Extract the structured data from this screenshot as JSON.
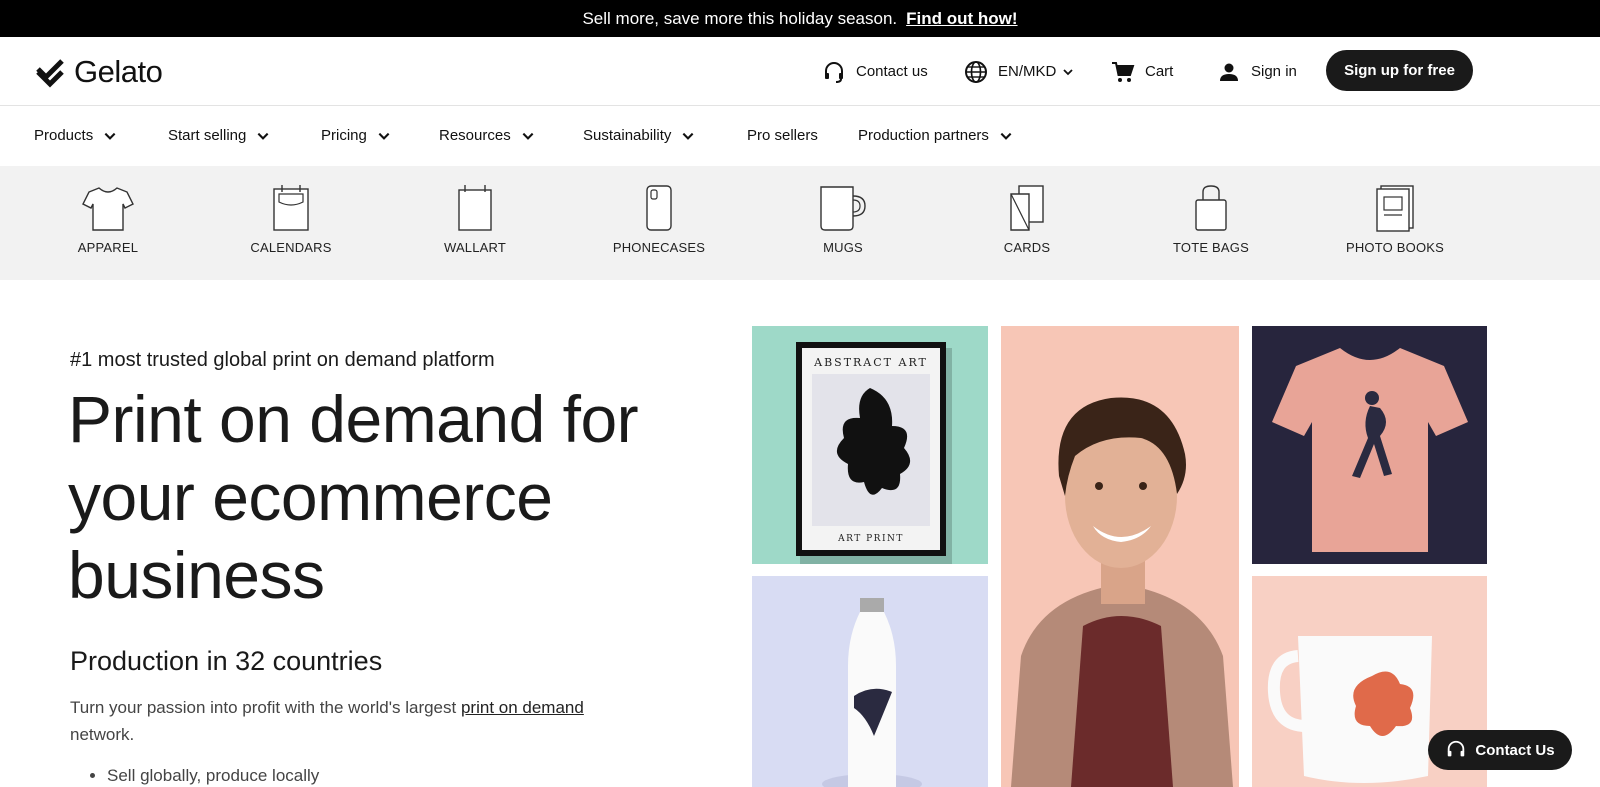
{
  "announcement": {
    "text": "Sell more, save more this holiday season.",
    "link": "Find out how!"
  },
  "header": {
    "logo": "Gelato",
    "contact": "Contact us",
    "language": "EN/MKD",
    "cart": "Cart",
    "sign_in": "Sign in",
    "signup": "Sign up for free"
  },
  "nav": {
    "items": [
      {
        "label": "Products"
      },
      {
        "label": "Start selling"
      },
      {
        "label": "Pricing"
      },
      {
        "label": "Resources"
      },
      {
        "label": "Sustainability"
      },
      {
        "label": "Pro sellers"
      },
      {
        "label": "Production partners"
      }
    ]
  },
  "categories": [
    {
      "label": "APPAREL",
      "icon": "tshirt-icon"
    },
    {
      "label": "CALENDARS",
      "icon": "calendar-icon"
    },
    {
      "label": "WALLART",
      "icon": "wallart-icon"
    },
    {
      "label": "PHONECASES",
      "icon": "phonecase-icon"
    },
    {
      "label": "MUGS",
      "icon": "mug-icon"
    },
    {
      "label": "CARDS",
      "icon": "cards-icon"
    },
    {
      "label": "TOTE BAGS",
      "icon": "tote-bag-icon"
    },
    {
      "label": "PHOTO BOOKS",
      "icon": "photo-book-icon"
    }
  ],
  "hero": {
    "eyebrow": "#1 most trusted global print on demand platform",
    "title": "Print on demand for your ecommerce business",
    "subtitle": "Production in 32 countries",
    "desc_before": "Turn your passion into profit with the world's largest ",
    "desc_link": "print on demand",
    "desc_after": " network.",
    "bullets": [
      "Sell globally, produce locally"
    ]
  },
  "art_print": {
    "top": "ABSTRACT ART",
    "bottom": "ART PRINT"
  },
  "contact_float": "Contact Us",
  "colors": {
    "brand": "#1a1a1a",
    "category_bg": "#f2f2f2",
    "announcement_bg": "#000000"
  }
}
